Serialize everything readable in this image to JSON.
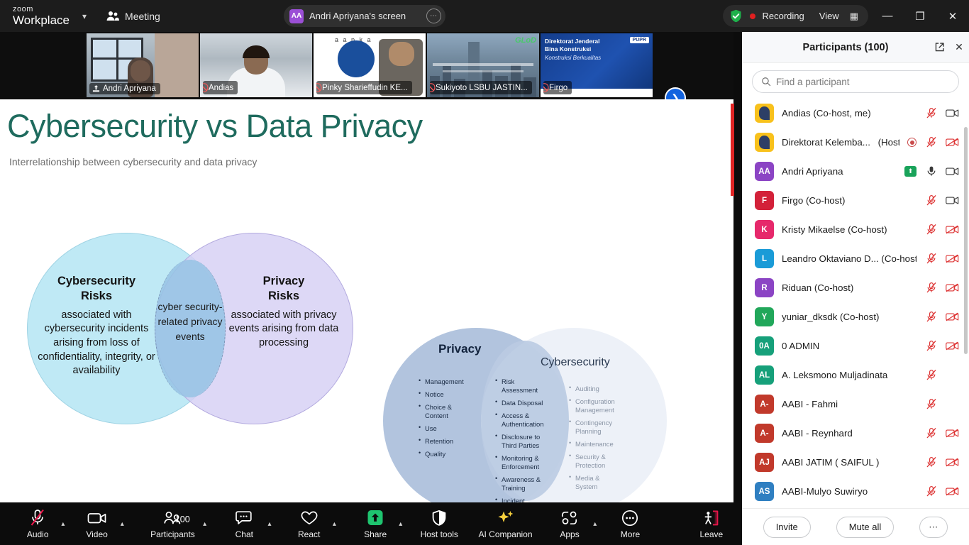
{
  "titlebar": {
    "logo_top": "zoom",
    "logo_bottom": "Workplace",
    "logo_caret": "chevron-down",
    "meeting_label": "Meeting",
    "share_pill": {
      "avatar_initials": "AA",
      "title": "Andri Apriyana's screen",
      "more": "⋯"
    },
    "recording_label": "Recording",
    "view_label": "View",
    "minimize": "—",
    "maximize": "❐",
    "close": "✕"
  },
  "thumbnails": [
    {
      "name": "Andri Apriyana",
      "muted": false,
      "active": true,
      "sharing": true
    },
    {
      "name": "Andias",
      "muted": true,
      "active": false
    },
    {
      "name": "Pinky Sharieffudin KE...",
      "muted": true,
      "active": false
    },
    {
      "name": "Sukiyoto LSBU JASTIN...",
      "muted": true,
      "active": false
    },
    {
      "name": "Firgo",
      "muted": true,
      "active": false
    }
  ],
  "thumb_next_icon": "chevron-right",
  "slide": {
    "title": "Cybersecurity vs Data Privacy",
    "subtitle": "Interrelationship between cybersecurity and data privacy",
    "title_color": "#1f6b5e",
    "venn_left": {
      "left_heading": "Cybersecurity\nRisks",
      "left_body": "associated with cybersecurity incidents arising from loss of confidentiality, integrity, or availability",
      "overlap_text": "cyber security-related privacy events",
      "right_heading": "Privacy\nRisks",
      "right_body": "associated with privacy events arising from data processing"
    },
    "venn_right": {
      "left_label": "Privacy",
      "right_label": "Cybersecurity",
      "privacy_only": [
        "Management",
        "Notice",
        "Choice & Content",
        "Use",
        "Retention",
        "Quality"
      ],
      "overlap": [
        "Risk Assessment",
        "Data Disposal",
        "Access & Authentication",
        "Disclosure to Third Parties",
        "Monitoring & Enforcement",
        "Awareness & Training",
        "Incident Response"
      ],
      "cybersecurity_only": [
        "Auditing",
        "Configuration Management",
        "Contingency Planning",
        "Maintenance",
        "Security & Protection",
        "Media & System"
      ]
    }
  },
  "toolbar": [
    {
      "label": "Audio",
      "icon": "microphone-muted-icon",
      "caret": true,
      "muted": true
    },
    {
      "label": "Video",
      "icon": "video-camera-icon",
      "caret": true
    },
    {
      "label": "Participants",
      "icon": "participants-icon",
      "caret": true,
      "count": "100"
    },
    {
      "label": "Chat",
      "icon": "chat-bubble-icon",
      "caret": true
    },
    {
      "label": "React",
      "icon": "heart-icon",
      "caret": true
    },
    {
      "label": "Share",
      "icon": "share-screen-icon",
      "caret": true
    },
    {
      "label": "Host tools",
      "icon": "shield-icon",
      "caret": false
    },
    {
      "label": "AI Companion",
      "icon": "sparkle-icon",
      "caret": false
    },
    {
      "label": "Apps",
      "icon": "apps-icon",
      "caret": true
    },
    {
      "label": "More",
      "icon": "more-dots-icon",
      "caret": false
    },
    {
      "label": "Leave",
      "icon": "leave-door-icon",
      "caret": false
    }
  ],
  "panel": {
    "title": "Participants (100)",
    "popout_icon": "popout-icon",
    "close_icon": "close-icon",
    "search_placeholder": "Find a participant",
    "participants": [
      {
        "name": "Andias (Co-host, me)",
        "initials": "",
        "avatar": "zoom",
        "color": "#f8c11c",
        "mic": "muted",
        "cam": "on"
      },
      {
        "name": "Direktorat Kelemba...",
        "role": "(Host)",
        "initials": "",
        "avatar": "zoom",
        "color": "#f8c11c",
        "recording": true,
        "mic": "muted",
        "cam": "off"
      },
      {
        "name": "Andri Apriyana",
        "initials": "AA",
        "color": "#8b44c4",
        "sharing": true,
        "mic": "on",
        "cam": "on"
      },
      {
        "name": "Firgo (Co-host)",
        "initials": "F",
        "color": "#d32139",
        "mic": "muted",
        "cam": "on"
      },
      {
        "name": "Kristy Mikaelse (Co-host)",
        "initials": "K",
        "color": "#e6286b",
        "mic": "muted",
        "cam": "off"
      },
      {
        "name": "Leandro Oktaviano D... (Co-host)",
        "initials": "L",
        "color": "#1a9bd7",
        "mic": "muted",
        "cam": "off"
      },
      {
        "name": "Riduan (Co-host)",
        "initials": "R",
        "color": "#8b44c4",
        "mic": "muted",
        "cam": "off"
      },
      {
        "name": "yuniar_dksdk (Co-host)",
        "initials": "Y",
        "color": "#21a75a",
        "mic": "muted",
        "cam": "off"
      },
      {
        "name": "0 ADMIN",
        "initials": "0A",
        "color": "#16a07a",
        "mic": "muted",
        "cam": "off"
      },
      {
        "name": "A. Leksmono Muljadinata",
        "initials": "AL",
        "color": "#16a07a",
        "mic": "muted",
        "cam": "none"
      },
      {
        "name": "AABI - Fahmi",
        "initials": "A-",
        "color": "#c1392b",
        "mic": "muted",
        "cam": "none"
      },
      {
        "name": "AABI - Reynhard",
        "initials": "A-",
        "color": "#c1392b",
        "mic": "muted",
        "cam": "off"
      },
      {
        "name": "AABI JATIM ( SAIFUL )",
        "initials": "AJ",
        "color": "#c1392b",
        "mic": "muted",
        "cam": "off"
      },
      {
        "name": "AABI-Mulyo Suwiryo",
        "initials": "AS",
        "color": "#2f7fc1",
        "mic": "muted",
        "cam": "off"
      }
    ],
    "footer": {
      "invite": "Invite",
      "mute_all": "Mute all",
      "more": "⋯"
    }
  }
}
